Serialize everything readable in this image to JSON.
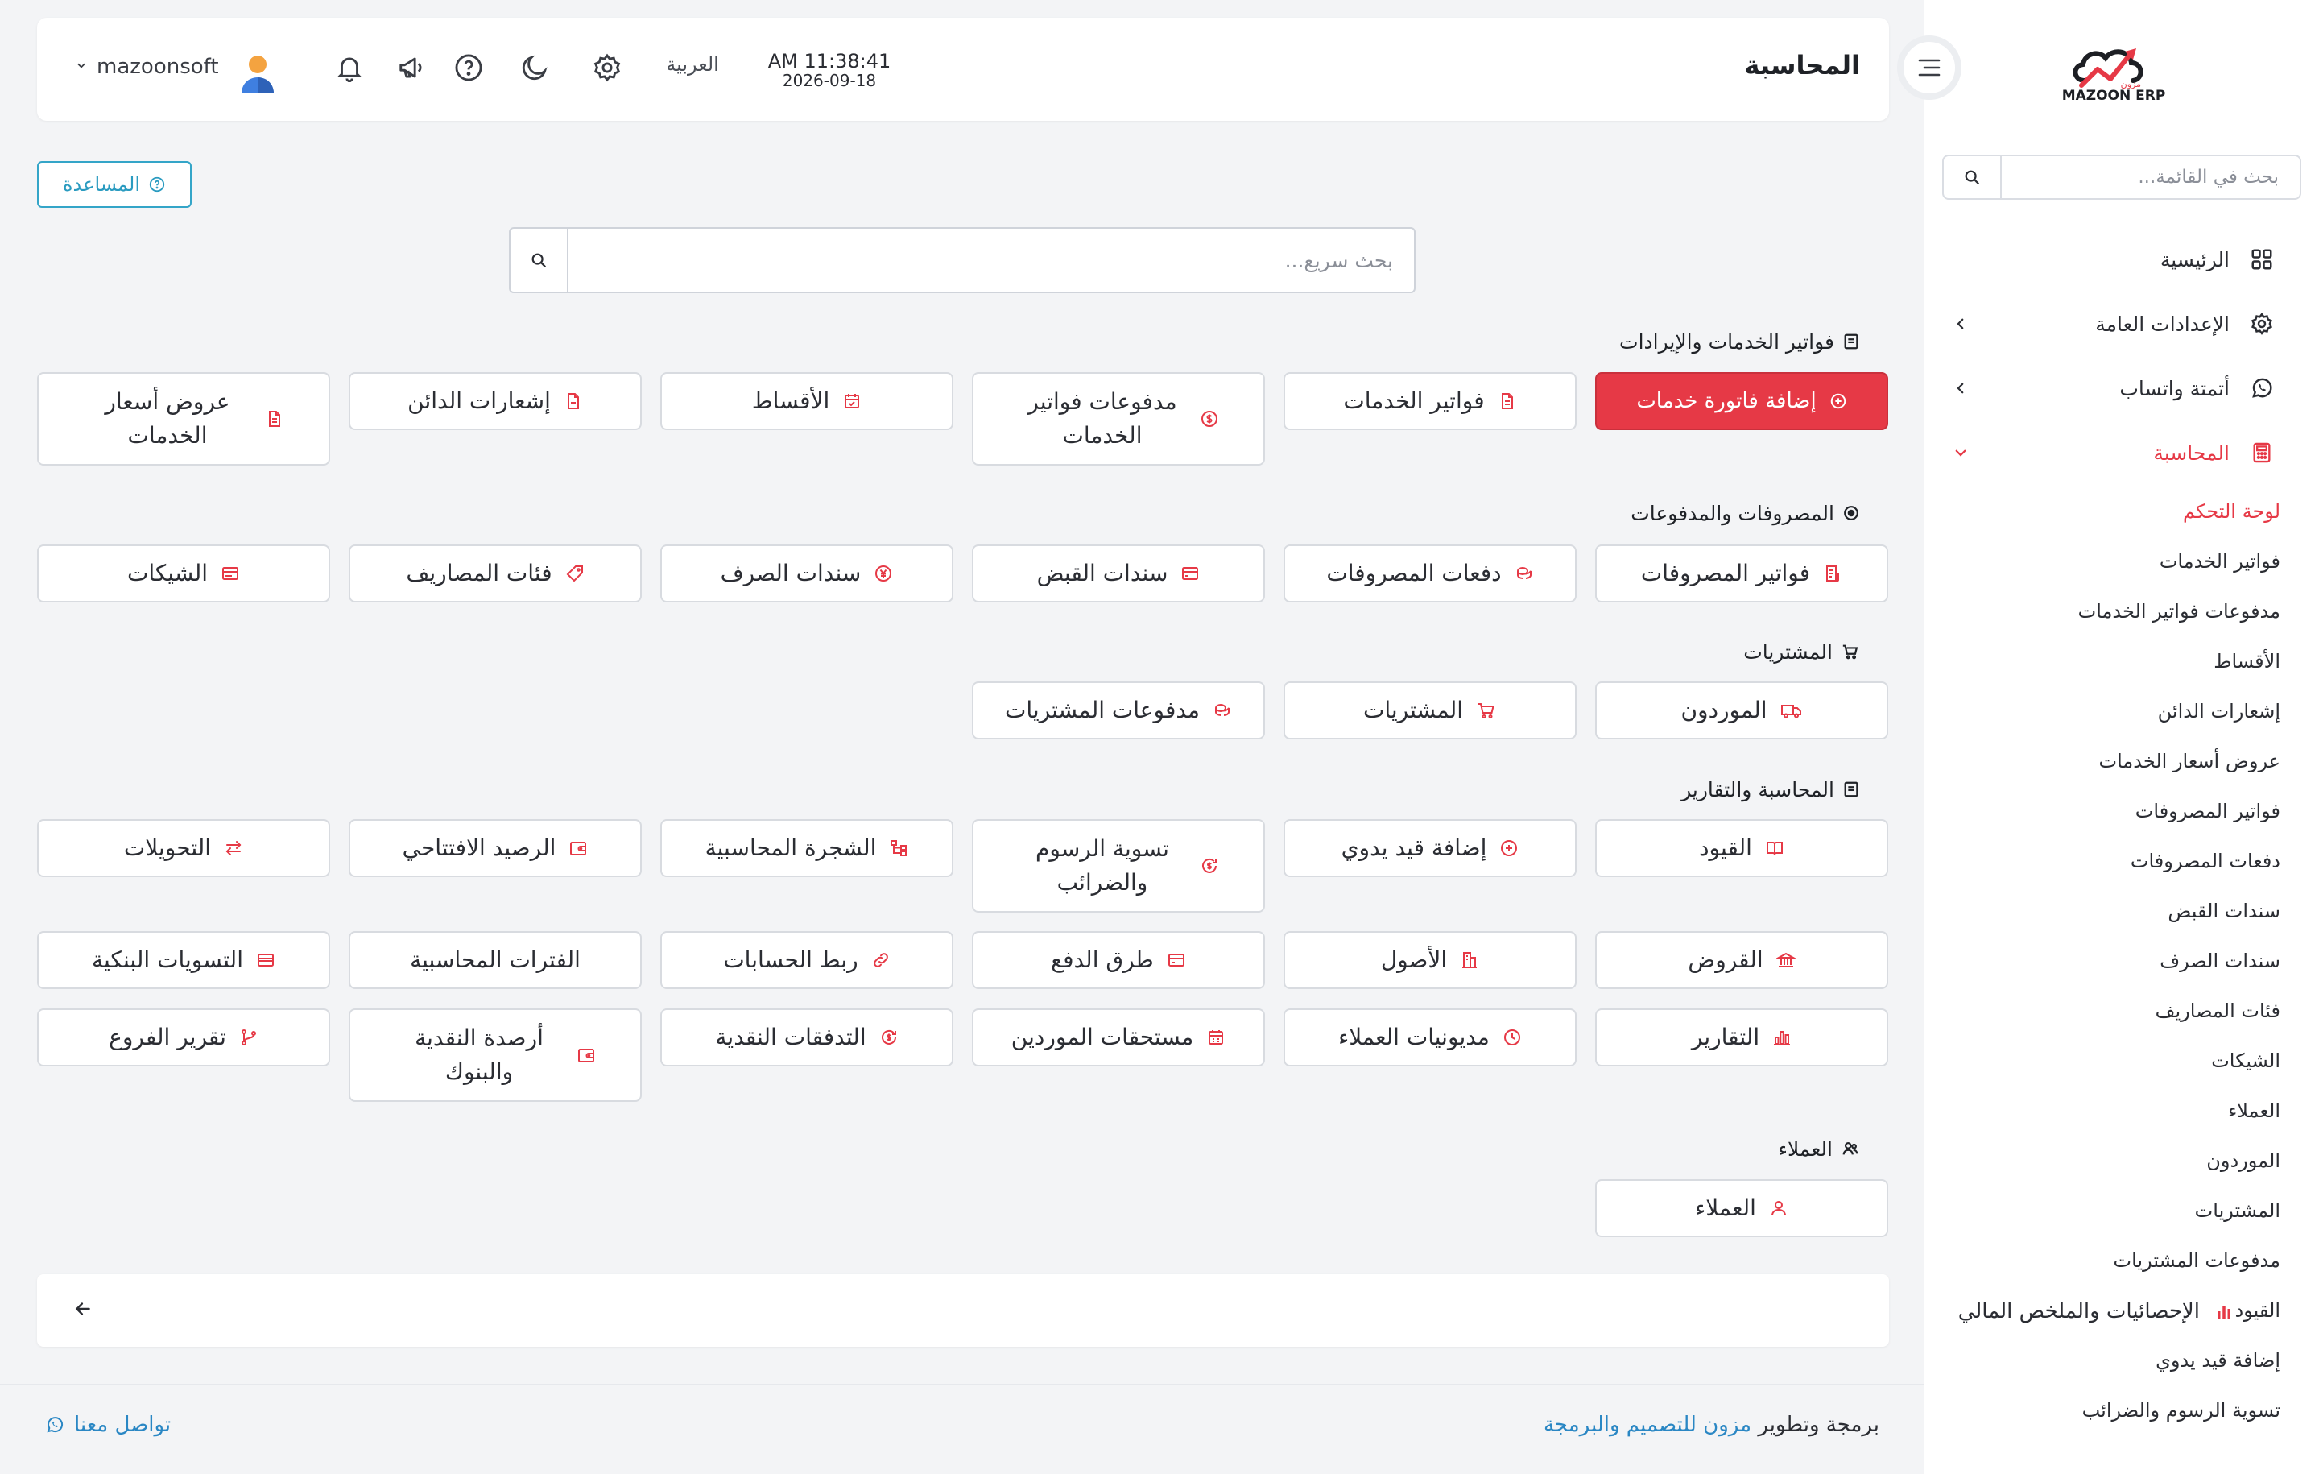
{
  "app": {
    "brand": "MAZOON ERP",
    "brand_sub": "مزون"
  },
  "colors": {
    "accent": "#e63946",
    "link": "#2a87c4",
    "help": "#2a9bc0"
  },
  "sidebar": {
    "search_placeholder": "بحث في القائمة...",
    "main_items": [
      {
        "label": "الرئيسية",
        "icon": "grid-icon"
      },
      {
        "label": "الإعدادات العامة",
        "icon": "gear-icon"
      },
      {
        "label": "أتمتة واتساب",
        "icon": "whatsapp-icon"
      },
      {
        "label": "المحاسبة",
        "icon": "calculator-icon"
      }
    ],
    "sub_items": [
      "لوحة التحكم",
      "فواتير الخدمات",
      "مدفوعات فواتير الخدمات",
      "الأقساط",
      "إشعارات الدائن",
      "عروض أسعار الخدمات",
      "فواتير المصروفات",
      "دفعات المصروفات",
      "سندات القبض",
      "سندات الصرف",
      "فئات المصاريف",
      "الشيكات",
      "العملاء",
      "الموردون",
      "المشتريات",
      "مدفوعات المشتريات",
      "القيود",
      "إضافة قيد يدوي",
      "تسوية الرسوم والضرائب"
    ]
  },
  "header": {
    "title": "المحاسبة",
    "time": "AM 11:38:41",
    "date": "2026-09-18",
    "language": "العربية",
    "user_name": "mazoonsoft"
  },
  "help_label": "المساعدة",
  "quick_search_placeholder": "بحث سريع...",
  "sections": [
    {
      "title": "فواتير الخدمات والإيرادات",
      "icon": "invoice-icon",
      "buttons": [
        "إضافة فاتورة خدمات",
        "فواتير الخدمات",
        "مدفوعات فواتير الخدمات",
        "الأقساط",
        "إشعارات الدائن",
        "عروض أسعار الخدمات"
      ]
    },
    {
      "title": "المصروفات والمدفوعات",
      "icon": "target-icon",
      "buttons": [
        "فواتير المصروفات",
        "دفعات المصروفات",
        "سندات القبض",
        "سندات الصرف",
        "فئات المصاريف",
        "الشيكات"
      ]
    },
    {
      "title": "المشتريات",
      "icon": "cart-icon",
      "buttons": [
        "الموردون",
        "المشتريات",
        "مدفوعات المشتريات"
      ]
    },
    {
      "title": "المحاسبة والتقارير",
      "icon": "ledger-icon",
      "buttons": [
        "القيود",
        "إضافة قيد يدوي",
        "تسوية الرسوم والضرائب",
        "الشجرة المحاسبية",
        "الرصيد الافتتاحي",
        "التحويلات",
        "القروض",
        "الأصول",
        "طرق الدفع",
        "ربط الحسابات",
        "الفترات المحاسبية",
        "التسويات البنكية",
        "التقارير",
        "مديونيات العملاء",
        "مستحقات الموردين",
        "التدفقات النقدية",
        "أرصدة النقدية والبنوك",
        "تقرير الفروع"
      ]
    },
    {
      "title": "العملاء",
      "icon": "users-icon",
      "buttons": [
        "العملاء"
      ]
    }
  ],
  "stats_label": "الإحصائيات والملخص المالي",
  "footer": {
    "credit_prefix": "برمجة وتطوير",
    "credit_link": "مزون للتصميم والبرمجة",
    "contact": "تواصل معنا"
  }
}
